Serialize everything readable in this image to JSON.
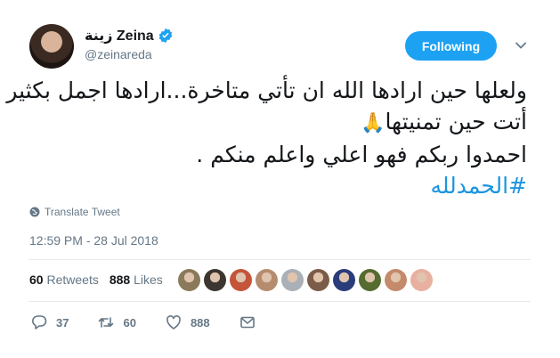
{
  "user": {
    "name": "زينة Zeina",
    "handle": "@zeinareda"
  },
  "follow_button": {
    "label": "Following"
  },
  "tweet": {
    "lines": [
      "ولعلها حين ارادها الله ان تأتي متاخرة...ارادها اجمل بكثير لو",
      "أتت حين تمنيتها",
      "احمدوا ربكم فهو اعلي واعلم منكم ."
    ],
    "emoji": "🙏",
    "hashtag": "#الحمدلله"
  },
  "translate": {
    "label": "Translate Tweet"
  },
  "timestamp": "12:59 PM - 28 Jul 2018",
  "stats": {
    "retweets_count": "60",
    "retweets_label": "Retweets",
    "likes_count": "888",
    "likes_label": "Likes"
  },
  "likers": [
    {
      "color": "#8a7a5a"
    },
    {
      "color": "#3d3530"
    },
    {
      "color": "#c4553a"
    },
    {
      "color": "#b58d6e"
    },
    {
      "color": "#aab0b6"
    },
    {
      "color": "#7b5c48"
    },
    {
      "color": "#2a3c7a"
    },
    {
      "color": "#556b2f"
    },
    {
      "color": "#c48a6a"
    },
    {
      "color": "#e8b0a0"
    }
  ],
  "actions": {
    "reply_count": "37",
    "retweet_count": "60",
    "like_count": "888"
  },
  "colors": {
    "accent": "#1da1f2",
    "link": "#1b95e0",
    "muted": "#657786"
  }
}
